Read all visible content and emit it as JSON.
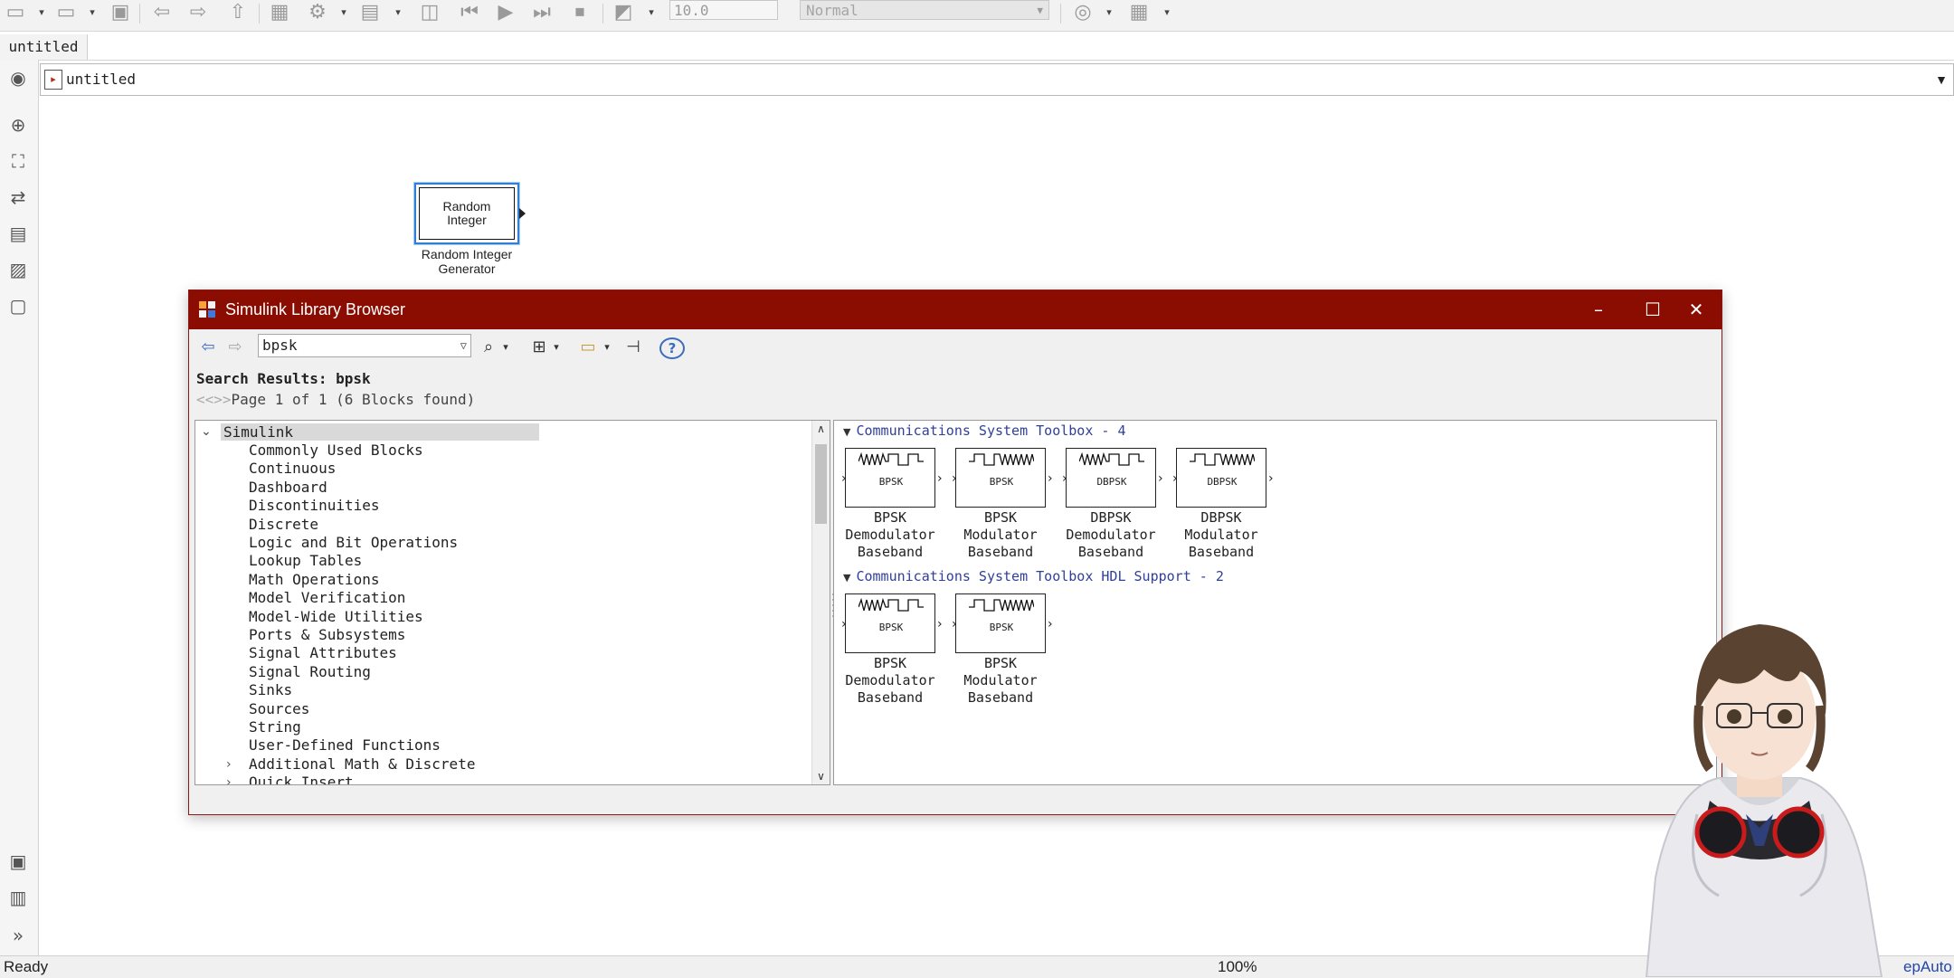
{
  "toolbar": {
    "stop_time": "10.0",
    "sim_mode": "Normal"
  },
  "tab": {
    "label": "untitled"
  },
  "address": {
    "path": "untitled"
  },
  "canvas": {
    "block": {
      "face": "Random\nInteger",
      "label": "Random Integer\nGenerator"
    }
  },
  "status": {
    "left": "Ready",
    "zoom": "100%",
    "right": "epAuto"
  },
  "library": {
    "title": "Simulink Library Browser",
    "search_value": "bpsk",
    "results_title": "Search Results: bpsk",
    "page_nav": "<<>>",
    "page_info": "Page 1 of 1 (6 Blocks found)",
    "tree": {
      "root": "Simulink",
      "items": [
        "Commonly Used Blocks",
        "Continuous",
        "Dashboard",
        "Discontinuities",
        "Discrete",
        "Logic and Bit Operations",
        "Lookup Tables",
        "Math Operations",
        "Model Verification",
        "Model-Wide Utilities",
        "Ports & Subsystems",
        "Signal Attributes",
        "Signal Routing",
        "Sinks",
        "Sources",
        "String",
        "User-Defined Functions"
      ],
      "collapsed": [
        "Additional Math & Discrete",
        "Quick Insert"
      ]
    },
    "groups": [
      {
        "header": "Communications System Toolbox - 4",
        "blocks": [
          {
            "face": "BPSK",
            "label": "BPSK\nDemodulator\nBaseband"
          },
          {
            "face": "BPSK",
            "label": "BPSK\nModulator\nBaseband"
          },
          {
            "face": "DBPSK",
            "label": "DBPSK\nDemodulator\nBaseband"
          },
          {
            "face": "DBPSK",
            "label": "DBPSK\nModulator\nBaseband"
          }
        ]
      },
      {
        "header": "Communications System Toolbox HDL Support - 2",
        "blocks": [
          {
            "face": "BPSK",
            "label": "BPSK\nDemodulator\nBaseband"
          },
          {
            "face": "BPSK",
            "label": "BPSK\nModulator\nBaseband"
          }
        ]
      }
    ]
  },
  "colors": {
    "titlebar": "#8b0d02",
    "selection": "#2d7fd8",
    "group_link": "#2f3f9a"
  },
  "icons": {
    "toolbar": [
      "new-model-icon",
      "open-icon",
      "save-icon",
      "undo-icon",
      "redo-icon",
      "up-icon",
      "library-browser-icon",
      "model-settings-icon",
      "step-back-icon",
      "run-icon",
      "step-forward-icon",
      "stop-icon",
      "data-inspector-icon",
      "update-icon",
      "build-icon"
    ],
    "palette": [
      "zoom-icon",
      "fit-view-icon",
      "arrows-icon",
      "annotation-icon",
      "image-icon",
      "area-icon",
      "screenshot-icon",
      "model-browser-icon",
      "expand-icon"
    ]
  }
}
